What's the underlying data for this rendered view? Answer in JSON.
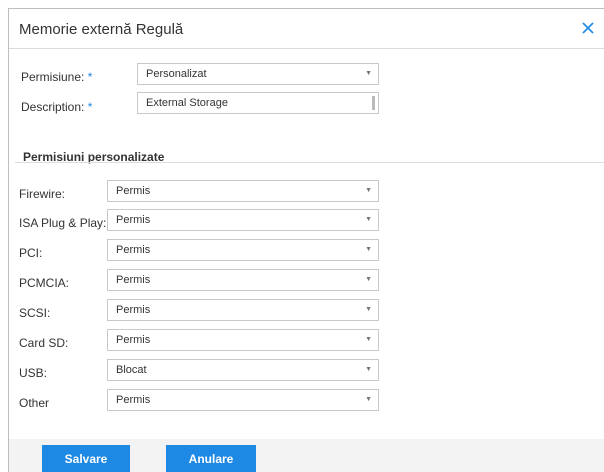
{
  "dialog": {
    "title": "Memorie externă Regulă"
  },
  "form": {
    "permission_label": "Permisiune:",
    "permission_required": "*",
    "permission_value": "Personalizat",
    "description_label": "Description:",
    "description_required": "*",
    "description_value": "External Storage"
  },
  "custom_permissions": {
    "title": "Permisiuni personalizate",
    "rows": [
      {
        "label": "Firewire:",
        "value": "Permis"
      },
      {
        "label": "ISA Plug & Play:",
        "value": "Permis"
      },
      {
        "label": "PCI:",
        "value": "Permis"
      },
      {
        "label": "PCMCIA:",
        "value": "Permis"
      },
      {
        "label": "SCSI:",
        "value": "Permis"
      },
      {
        "label": "Card SD:",
        "value": "Permis"
      },
      {
        "label": "USB:",
        "value": "Blocat"
      },
      {
        "label": "Other",
        "value": "Permis"
      }
    ]
  },
  "footer": {
    "save_label": "Salvare",
    "cancel_label": "Anulare"
  },
  "colors": {
    "accent": "#1e88e5"
  }
}
